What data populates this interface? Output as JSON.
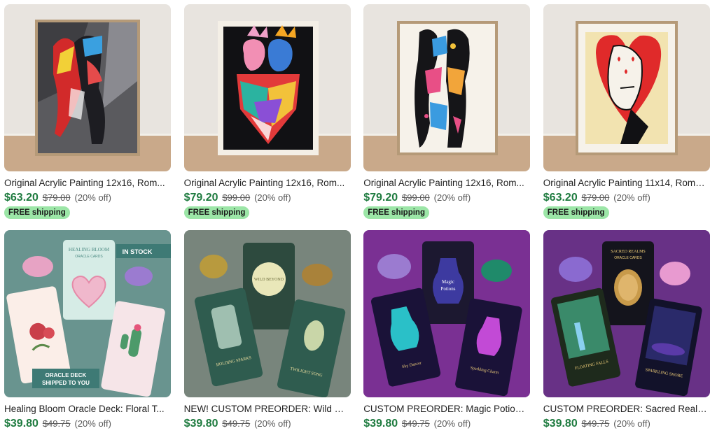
{
  "colors": {
    "price": "#1e7b3f",
    "shipping_badge": "#9ce6a7"
  },
  "listings": [
    {
      "title": "Original Acrylic Painting 12x16, Rom...",
      "price": "$63.20",
      "original_price": "$79.00",
      "discount": "(20% off)",
      "badge": "FREE shipping",
      "image": "painting-dancing-couple"
    },
    {
      "title": "Original Acrylic Painting 12x16, Rom...",
      "price": "$79.20",
      "original_price": "$99.00",
      "discount": "(20% off)",
      "badge": "FREE shipping",
      "image": "painting-embracing-couple"
    },
    {
      "title": "Original Acrylic Painting 12x16, Rom...",
      "price": "$79.20",
      "original_price": "$99.00",
      "discount": "(20% off)",
      "badge": "FREE shipping",
      "image": "painting-kissing-couple"
    },
    {
      "title": "Original Acrylic Painting 11x14, Roma...",
      "price": "$63.20",
      "original_price": "$79.00",
      "discount": "(20% off)",
      "badge": "FREE shipping",
      "image": "painting-face-heart"
    },
    {
      "title": "Healing Bloom Oracle Deck: Floral T...",
      "price": "$39.80",
      "original_price": "$49.75",
      "discount": "(20% off)",
      "image": "oracle-deck-healing-bloom",
      "overlay": {
        "in_stock": "IN STOCK",
        "deck_name_1": "HEALING BLOOM",
        "deck_name_2": "ORACLE CARDS",
        "banner_1": "ORACLE DECK",
        "banner_2": "SHIPPED TO YOU"
      }
    },
    {
      "title": "NEW! CUSTOM PREORDER: Wild Bey...",
      "price": "$39.80",
      "original_price": "$49.75",
      "discount": "(20% off)",
      "image": "oracle-deck-wild-beyond",
      "overlay": {
        "card_1": "HOLDING SPARKS",
        "card_2": "TWILIGHT SONG",
        "deck_name": "WILD BEYOND"
      }
    },
    {
      "title": "CUSTOM PREORDER: Magic Potions ...",
      "price": "$39.80",
      "original_price": "$49.75",
      "discount": "(20% off)",
      "image": "oracle-deck-magic-potions",
      "overlay": {
        "deck_name_1": "Magic",
        "deck_name_2": "Potions",
        "card_1": "Sky Dancer",
        "card_2": "Sparkling Charm"
      }
    },
    {
      "title": "CUSTOM PREORDER: Sacred Realms...",
      "price": "$39.80",
      "original_price": "$49.75",
      "discount": "(20% off)",
      "image": "oracle-deck-sacred-realms",
      "overlay": {
        "deck_name_1": "SACRED REALMS",
        "deck_name_2": "ORACLE CARDS",
        "card_1": "FLOATING FALLS",
        "card_2": "SPARKLING SHORE"
      }
    }
  ]
}
